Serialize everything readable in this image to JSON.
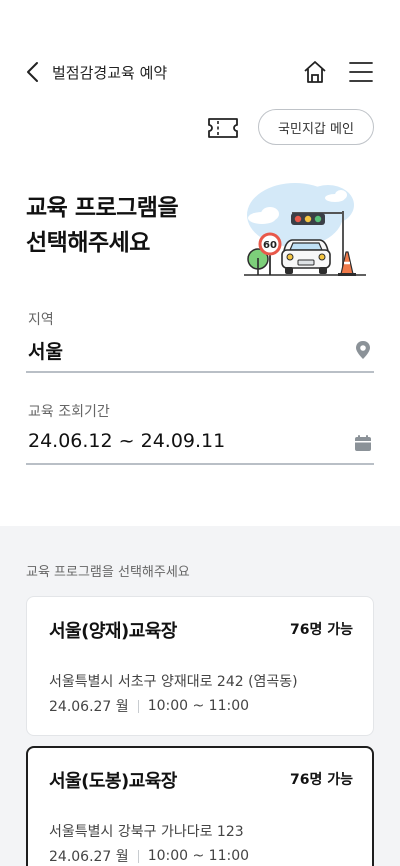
{
  "header": {
    "title": "벌점감경교육 예약"
  },
  "toolbar": {
    "wallet_label": "국민지갑 메인"
  },
  "page": {
    "title": "교육 프로그램을\n선택해주세요"
  },
  "illustration": {
    "speed_sign": "60"
  },
  "region": {
    "label": "지역",
    "value": "서울"
  },
  "period": {
    "label": "교육 조회기간",
    "value": "24.06.12 ~ 24.09.11"
  },
  "programs": {
    "caption": "교육 프로그램을 선택해주세요",
    "items": [
      {
        "name": "서울(양재)교육장",
        "availability": "76명 가능",
        "address": "서울특별시 서초구 양재대로 242 (염곡동)",
        "date": "24.06.27 월",
        "time": "10:00 ~ 11:00",
        "selected": false
      },
      {
        "name": "서울(도봉)교육장",
        "availability": "76명 가능",
        "address": "서울특별시 강북구 가나다로 123",
        "date": "24.06.27 월",
        "time": "10:00 ~ 11:00",
        "selected": true
      }
    ]
  },
  "colors": {
    "accent": "#1e1e1e",
    "line": "#b9bfc6",
    "section_bg": "#f3f4f6",
    "sky": "#cfe6f7",
    "cone": "#f07a4a"
  }
}
